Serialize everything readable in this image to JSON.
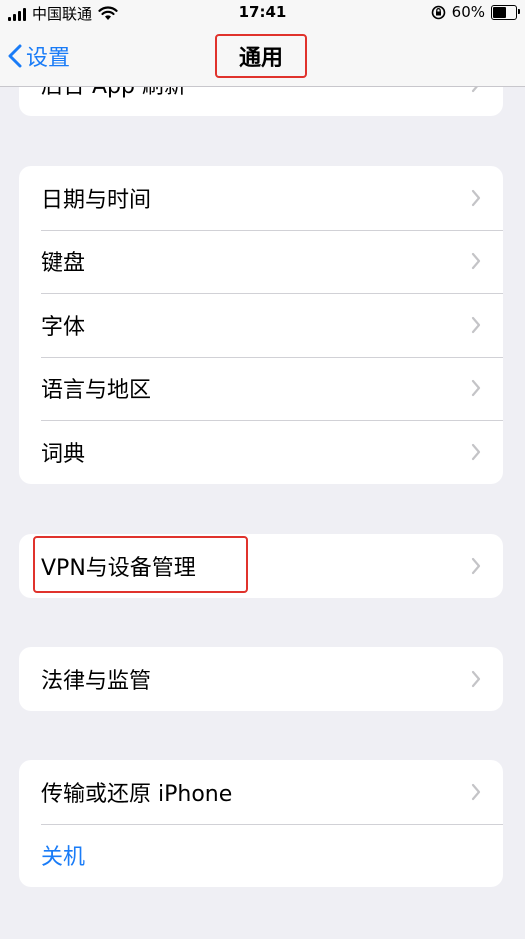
{
  "status_bar": {
    "carrier": "中国联通",
    "time": "17:41",
    "battery": "60%",
    "battery_level": 0.6
  },
  "nav": {
    "back_label": "设置",
    "title": "通用"
  },
  "groups": [
    {
      "items": [
        {
          "label": "后台 App 刷新"
        }
      ]
    },
    {
      "items": [
        {
          "label": "日期与时间"
        },
        {
          "label": "键盘"
        },
        {
          "label": "字体"
        },
        {
          "label": "语言与地区"
        },
        {
          "label": "词典"
        }
      ]
    },
    {
      "items": [
        {
          "label": "VPN与设备管理"
        }
      ]
    },
    {
      "items": [
        {
          "label": "法律与监管"
        }
      ]
    },
    {
      "items": [
        {
          "label": "传输或还原 iPhone"
        },
        {
          "label": "关机",
          "color": "#1a7cf7"
        }
      ]
    }
  ],
  "colors": {
    "accent": "#1a7cf7",
    "highlight": "#e0322c",
    "background": "#efeff4"
  }
}
